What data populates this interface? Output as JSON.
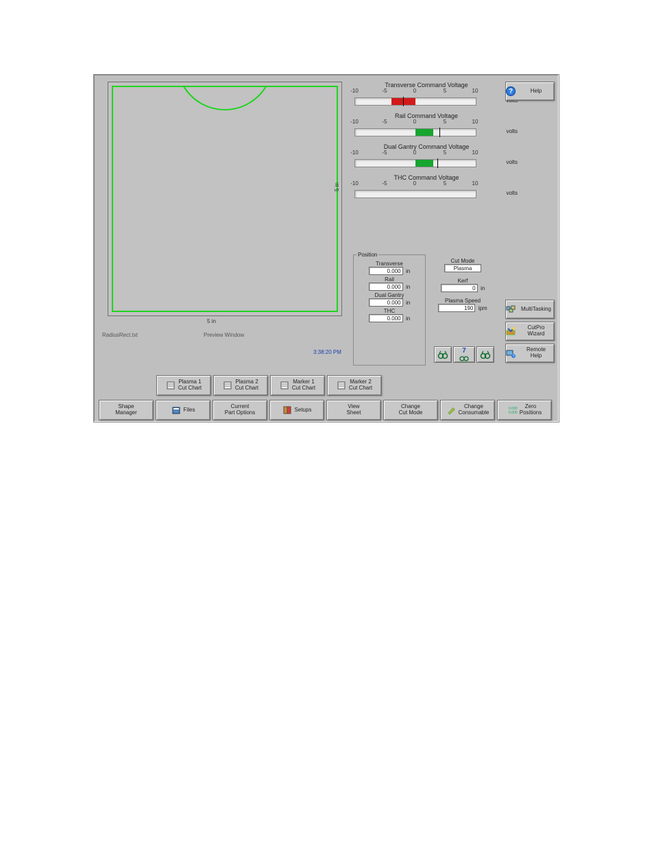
{
  "preview": {
    "x_scale_label": "5 in",
    "y_scale_label": "5 in",
    "filename": "RadiusRect.txt",
    "window_title": "Preview Window",
    "clock": "3:38:20 PM"
  },
  "meters": [
    {
      "title": "Transverse Command Voltage",
      "unit": "volts",
      "min": -10,
      "max": 10,
      "value": -2,
      "fill_from": -4,
      "fill_to": 0,
      "color": "#d21a1a"
    },
    {
      "title": "Rail Command Voltage",
      "unit": "volts",
      "min": -10,
      "max": 10,
      "value": 4,
      "fill_from": 0,
      "fill_to": 3,
      "color": "#17a52f"
    },
    {
      "title": "Dual Gantry Command Voltage",
      "unit": "volts",
      "min": -10,
      "max": 10,
      "value": 4,
      "fill_from": 0,
      "fill_to": 3,
      "color": "#17a52f"
    },
    {
      "title": "THC Command Voltage",
      "unit": "volts",
      "min": -10,
      "max": 10,
      "value": 0,
      "fill_from": 0,
      "fill_to": 0,
      "color": "#17a52f"
    }
  ],
  "position": {
    "legend": "Position",
    "fields": [
      {
        "label": "Transverse",
        "value": "0.000",
        "unit": "in"
      },
      {
        "label": "Rail",
        "value": "0.000",
        "unit": "in"
      },
      {
        "label": "Dual Gantry",
        "value": "0.000",
        "unit": "in"
      },
      {
        "label": "THC",
        "value": "0.000",
        "unit": "in"
      }
    ]
  },
  "cut": {
    "mode_label": "Cut Mode",
    "mode_value": "Plasma",
    "kerf_label": "Kerf",
    "kerf_value": "0",
    "kerf_unit": "in",
    "speed_label": "Plasma Speed",
    "speed_value": "190",
    "speed_unit": "ipm"
  },
  "side_buttons": {
    "help": "Help",
    "multitasking": "MultiTasking",
    "cutpro_wizard": "CutPro\nWizard",
    "remote_help": "Remote\nHelp"
  },
  "view_buttons": {
    "view_number": "7"
  },
  "row_a": [
    {
      "id": "plasma1-cutchart",
      "label": "Plasma 1\nCut Chart"
    },
    {
      "id": "plasma2-cutchart",
      "label": "Plasma 2\nCut Chart"
    },
    {
      "id": "marker1-cutchart",
      "label": "Marker 1\nCut Chart"
    },
    {
      "id": "marker2-cutchart",
      "label": "Marker 2\nCut Chart"
    }
  ],
  "row_b": [
    {
      "id": "shape-manager",
      "label": "Shape\nManager"
    },
    {
      "id": "files",
      "label": "Files"
    },
    {
      "id": "current-part-options",
      "label": "Current\nPart Options"
    },
    {
      "id": "setups",
      "label": "Setups"
    },
    {
      "id": "view-sheet",
      "label": "View\nSheet"
    },
    {
      "id": "change-cut-mode",
      "label": "Change\nCut Mode"
    },
    {
      "id": "change-consumable",
      "label": "Change\nConsumable"
    },
    {
      "id": "zero-positions",
      "label": "Zero\nPositions"
    }
  ]
}
